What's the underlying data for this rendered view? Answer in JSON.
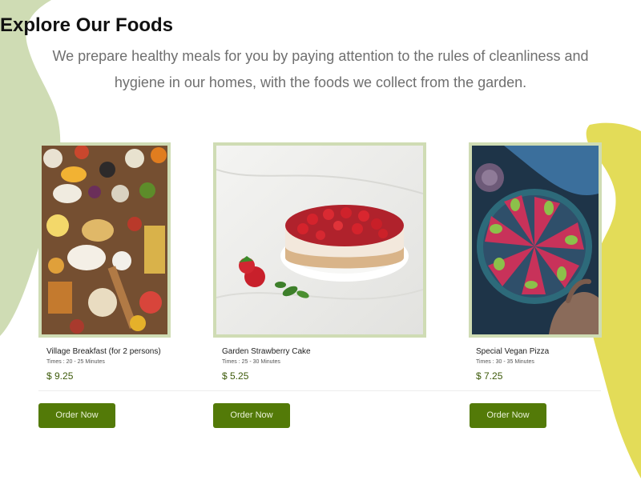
{
  "page": {
    "title": "Explore Our Foods",
    "subtitle": "We prepare healthy meals for you by paying attention to the rules of cleanliness and hygiene in our homes, with the foods we collect from the garden."
  },
  "colors": {
    "accent_green": "#537a08",
    "frame_green": "#cfdcb4",
    "blob_green": "#cfdcb4",
    "blob_yellow": "#e3dc58",
    "price_green": "#3d5a0a"
  },
  "foods": [
    {
      "name": "Village Breakfast (for 2 persons)",
      "time": "Times : 20 - 25 Minutes",
      "price": "$ 9.25",
      "button": "Order Now",
      "image": "breakfast-spread-photo"
    },
    {
      "name": "Garden Strawberry Cake",
      "time": "Times : 25 - 30 Minutes",
      "price": "$ 5.25",
      "button": "Order Now",
      "image": "strawberry-cake-photo"
    },
    {
      "name": "Special Vegan Pizza",
      "time": "Times : 30 - 35 Minutes",
      "price": "$ 7.25",
      "button": "Order Now",
      "image": "vegan-pizza-photo"
    }
  ]
}
